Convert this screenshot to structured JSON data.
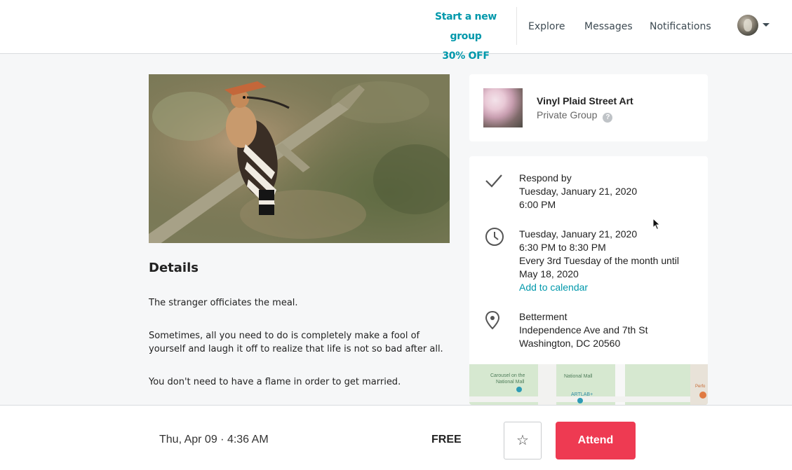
{
  "nav": {
    "promo_line1": "Start a new group",
    "promo_line2": "30% OFF",
    "explore": "Explore",
    "messages": "Messages",
    "notifications": "Notifications"
  },
  "details": {
    "title": "Details",
    "paragraphs": [
      "The stranger officiates the meal.",
      "Sometimes, all you need to do is completely make a fool of yourself and laugh it off to realize that life is not so bad after all.",
      "You don't need to have a flame in order to get married."
    ]
  },
  "group": {
    "name": "Vinyl Plaid Street Art",
    "type": "Private Group",
    "help_glyph": "?"
  },
  "event": {
    "respond_label": "Respond by",
    "respond_date": "Tuesday, January 21, 2020",
    "respond_time": "6:00 PM",
    "date": "Tuesday, January 21, 2020",
    "time_range": "6:30 PM to 8:30 PM",
    "recurrence_line1": "Every 3rd Tuesday of the month until",
    "recurrence_line2": "May 18, 2020",
    "add_calendar": "Add to calendar",
    "venue": "Betterment",
    "address_line1": "Independence Ave and 7th St",
    "address_line2": "Washington, DC 20560"
  },
  "map": {
    "label_carousel_1": "Carousel on the",
    "label_carousel_2": "National Mall",
    "label_national_mall": "National Mall",
    "label_artlab": "ARTLAB+",
    "label_edge": "Perfo"
  },
  "bottom": {
    "datetime": "Thu, Apr 09 · 4:36 AM",
    "price": "FREE",
    "star_glyph": "☆",
    "attend": "Attend"
  },
  "colors": {
    "accent": "#0098ab",
    "attend": "#ee3a52",
    "background": "#f6f7f8"
  }
}
